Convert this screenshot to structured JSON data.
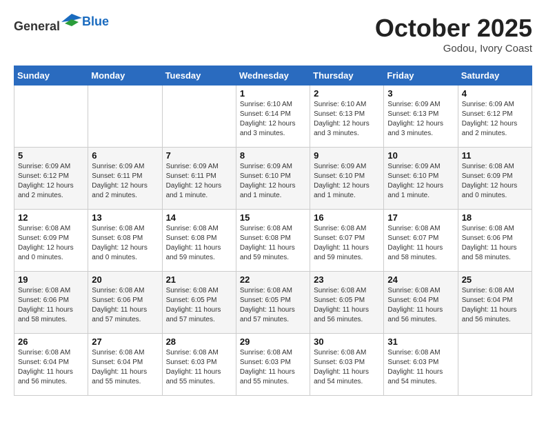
{
  "header": {
    "logo_general": "General",
    "logo_blue": "Blue",
    "month": "October 2025",
    "location": "Godou, Ivory Coast"
  },
  "weekdays": [
    "Sunday",
    "Monday",
    "Tuesday",
    "Wednesday",
    "Thursday",
    "Friday",
    "Saturday"
  ],
  "weeks": [
    [
      {
        "day": "",
        "detail": ""
      },
      {
        "day": "",
        "detail": ""
      },
      {
        "day": "",
        "detail": ""
      },
      {
        "day": "1",
        "detail": "Sunrise: 6:10 AM\nSunset: 6:14 PM\nDaylight: 12 hours\nand 3 minutes."
      },
      {
        "day": "2",
        "detail": "Sunrise: 6:10 AM\nSunset: 6:13 PM\nDaylight: 12 hours\nand 3 minutes."
      },
      {
        "day": "3",
        "detail": "Sunrise: 6:09 AM\nSunset: 6:13 PM\nDaylight: 12 hours\nand 3 minutes."
      },
      {
        "day": "4",
        "detail": "Sunrise: 6:09 AM\nSunset: 6:12 PM\nDaylight: 12 hours\nand 2 minutes."
      }
    ],
    [
      {
        "day": "5",
        "detail": "Sunrise: 6:09 AM\nSunset: 6:12 PM\nDaylight: 12 hours\nand 2 minutes."
      },
      {
        "day": "6",
        "detail": "Sunrise: 6:09 AM\nSunset: 6:11 PM\nDaylight: 12 hours\nand 2 minutes."
      },
      {
        "day": "7",
        "detail": "Sunrise: 6:09 AM\nSunset: 6:11 PM\nDaylight: 12 hours\nand 1 minute."
      },
      {
        "day": "8",
        "detail": "Sunrise: 6:09 AM\nSunset: 6:10 PM\nDaylight: 12 hours\nand 1 minute."
      },
      {
        "day": "9",
        "detail": "Sunrise: 6:09 AM\nSunset: 6:10 PM\nDaylight: 12 hours\nand 1 minute."
      },
      {
        "day": "10",
        "detail": "Sunrise: 6:09 AM\nSunset: 6:10 PM\nDaylight: 12 hours\nand 1 minute."
      },
      {
        "day": "11",
        "detail": "Sunrise: 6:08 AM\nSunset: 6:09 PM\nDaylight: 12 hours\nand 0 minutes."
      }
    ],
    [
      {
        "day": "12",
        "detail": "Sunrise: 6:08 AM\nSunset: 6:09 PM\nDaylight: 12 hours\nand 0 minutes."
      },
      {
        "day": "13",
        "detail": "Sunrise: 6:08 AM\nSunset: 6:08 PM\nDaylight: 12 hours\nand 0 minutes."
      },
      {
        "day": "14",
        "detail": "Sunrise: 6:08 AM\nSunset: 6:08 PM\nDaylight: 11 hours\nand 59 minutes."
      },
      {
        "day": "15",
        "detail": "Sunrise: 6:08 AM\nSunset: 6:08 PM\nDaylight: 11 hours\nand 59 minutes."
      },
      {
        "day": "16",
        "detail": "Sunrise: 6:08 AM\nSunset: 6:07 PM\nDaylight: 11 hours\nand 59 minutes."
      },
      {
        "day": "17",
        "detail": "Sunrise: 6:08 AM\nSunset: 6:07 PM\nDaylight: 11 hours\nand 58 minutes."
      },
      {
        "day": "18",
        "detail": "Sunrise: 6:08 AM\nSunset: 6:06 PM\nDaylight: 11 hours\nand 58 minutes."
      }
    ],
    [
      {
        "day": "19",
        "detail": "Sunrise: 6:08 AM\nSunset: 6:06 PM\nDaylight: 11 hours\nand 58 minutes."
      },
      {
        "day": "20",
        "detail": "Sunrise: 6:08 AM\nSunset: 6:06 PM\nDaylight: 11 hours\nand 57 minutes."
      },
      {
        "day": "21",
        "detail": "Sunrise: 6:08 AM\nSunset: 6:05 PM\nDaylight: 11 hours\nand 57 minutes."
      },
      {
        "day": "22",
        "detail": "Sunrise: 6:08 AM\nSunset: 6:05 PM\nDaylight: 11 hours\nand 57 minutes."
      },
      {
        "day": "23",
        "detail": "Sunrise: 6:08 AM\nSunset: 6:05 PM\nDaylight: 11 hours\nand 56 minutes."
      },
      {
        "day": "24",
        "detail": "Sunrise: 6:08 AM\nSunset: 6:04 PM\nDaylight: 11 hours\nand 56 minutes."
      },
      {
        "day": "25",
        "detail": "Sunrise: 6:08 AM\nSunset: 6:04 PM\nDaylight: 11 hours\nand 56 minutes."
      }
    ],
    [
      {
        "day": "26",
        "detail": "Sunrise: 6:08 AM\nSunset: 6:04 PM\nDaylight: 11 hours\nand 56 minutes."
      },
      {
        "day": "27",
        "detail": "Sunrise: 6:08 AM\nSunset: 6:04 PM\nDaylight: 11 hours\nand 55 minutes."
      },
      {
        "day": "28",
        "detail": "Sunrise: 6:08 AM\nSunset: 6:03 PM\nDaylight: 11 hours\nand 55 minutes."
      },
      {
        "day": "29",
        "detail": "Sunrise: 6:08 AM\nSunset: 6:03 PM\nDaylight: 11 hours\nand 55 minutes."
      },
      {
        "day": "30",
        "detail": "Sunrise: 6:08 AM\nSunset: 6:03 PM\nDaylight: 11 hours\nand 54 minutes."
      },
      {
        "day": "31",
        "detail": "Sunrise: 6:08 AM\nSunset: 6:03 PM\nDaylight: 11 hours\nand 54 minutes."
      },
      {
        "day": "",
        "detail": ""
      }
    ]
  ]
}
